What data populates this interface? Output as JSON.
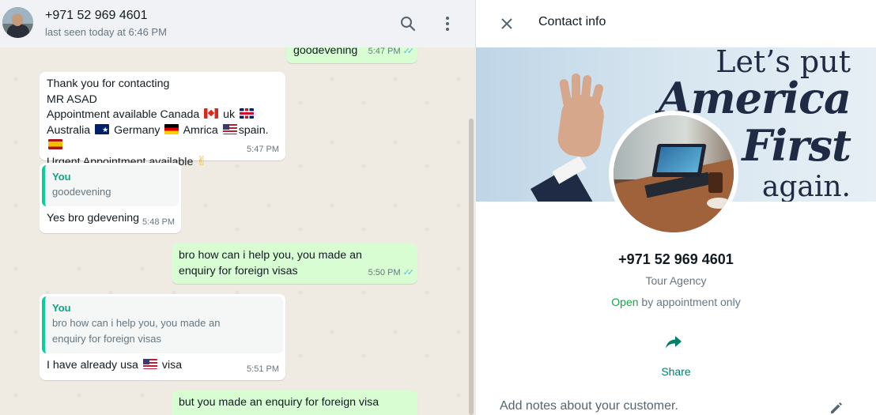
{
  "chat_header": {
    "name": "+971 52 969 4601",
    "status": "last seen today at 6:46 PM",
    "search_icon": "search-icon",
    "menu_icon": "kebab-menu-icon"
  },
  "messages": [
    {
      "dir": "out",
      "text": "goodevening",
      "time": "5:47 PM"
    },
    {
      "dir": "in",
      "lines": [
        "Thank you for contacting",
        "MR ASAD",
        "Appointment available Canada",
        "uk",
        "Australia",
        "Germany",
        "Amrica",
        "spain.",
        "Urgent Appointment available"
      ],
      "time": "5:47 PM"
    },
    {
      "dir": "in",
      "quote_author": "You",
      "quote_text": "goodevening",
      "text": "Yes bro gdevening",
      "time": "5:48 PM"
    },
    {
      "dir": "out",
      "text": "bro how can i help you, you made an enquiry for foreign visas",
      "time": "5:50 PM"
    },
    {
      "dir": "in",
      "quote_author": "You",
      "quote_text": "bro how can i help you, you made an enquiry for foreign visas",
      "text_before": "I have already usa",
      "text_after": "visa",
      "time": "5:51 PM"
    },
    {
      "dir": "out",
      "text": "but you made an enquiry for foreign visa"
    }
  ],
  "contact_info": {
    "title": "Contact info",
    "banner_lines": [
      "Let’s put",
      "America",
      "First",
      "again."
    ],
    "name": "+971 52 969 4601",
    "category": "Tour Agency",
    "hours_open": "Open",
    "hours_rest": " by appointment only",
    "share_label": "Share",
    "notes_placeholder": "Add notes about your customer."
  },
  "colors": {
    "incoming_bubble": "#ffffff",
    "outgoing_bubble": "#d9fdd3",
    "chat_background": "#efeae2",
    "accent_green": "#008069",
    "read_ticks": "#53bdeb"
  }
}
